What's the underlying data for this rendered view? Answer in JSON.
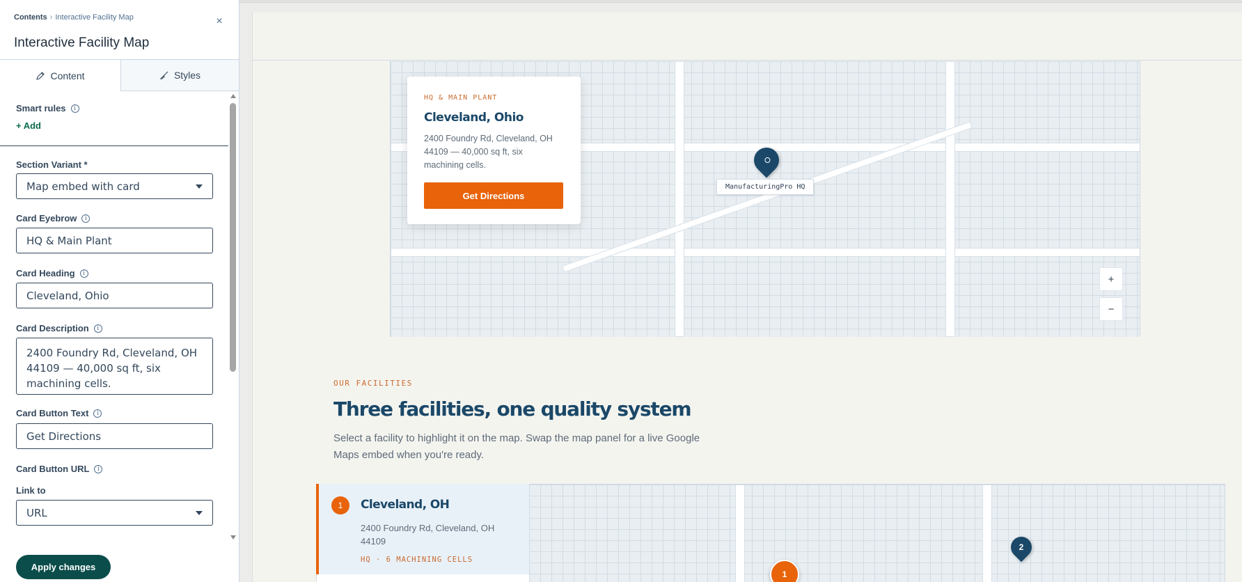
{
  "panel": {
    "breadcrumb_root": "Contents",
    "breadcrumb_separator": "›",
    "breadcrumb_current": "Interactive Facility Map",
    "title": "Interactive Facility Map",
    "close_icon": "×",
    "tabs": [
      {
        "label": "Content",
        "icon": "pencil-icon",
        "active": true
      },
      {
        "label": "Styles",
        "icon": "brush-icon",
        "active": false
      }
    ],
    "smart_rules_label": "Smart rules",
    "add_label": "+ Add",
    "section_variant": {
      "label": "Section Variant *",
      "value": "Map embed with card"
    },
    "card_eyebrow": {
      "label": "Card Eyebrow",
      "value": "HQ & Main Plant"
    },
    "card_heading": {
      "label": "Card Heading",
      "value": "Cleveland, Ohio"
    },
    "card_description": {
      "label": "Card Description",
      "value": "2400 Foundry Rd, Cleveland, OH 44109 — 40,000 sq ft, six machining cells."
    },
    "card_button_text": {
      "label": "Card Button Text",
      "value": "Get Directions"
    },
    "card_button_url": {
      "label": "Card Button URL"
    },
    "link_to": {
      "label": "Link to",
      "value": "URL"
    },
    "info_glyph": "i",
    "apply_label": "Apply changes"
  },
  "preview": {
    "map_card": {
      "eyebrow": "HQ & MAIN PLANT",
      "heading": "Cleveland, Ohio",
      "description": "2400 Foundry Rd, Cleveland, OH 44109 — 40,000 sq ft, six machining cells.",
      "button": "Get Directions"
    },
    "pin_label": "ManufacturingPro HQ",
    "zoom_in": "+",
    "zoom_out": "−",
    "section": {
      "eyebrow": "OUR FACILITIES",
      "title": "Three facilities, one quality system",
      "subtitle": "Select a facility to highlight it on the map. Swap the map panel for a live Google Maps embed when you're ready."
    },
    "facilities": [
      {
        "number": "1",
        "name": "Cleveland, OH",
        "address": "2400 Foundry Rd, Cleveland, OH 44109",
        "tag": "HQ · 6 MACHINING CELLS"
      }
    ],
    "map_pins": [
      {
        "number": "1",
        "color": "#e8630a"
      },
      {
        "number": "2",
        "color": "#1b4868"
      }
    ]
  },
  "colors": {
    "accent_orange": "#e8630a",
    "navy": "#1b4868",
    "apply_button": "#0b4d4b"
  }
}
